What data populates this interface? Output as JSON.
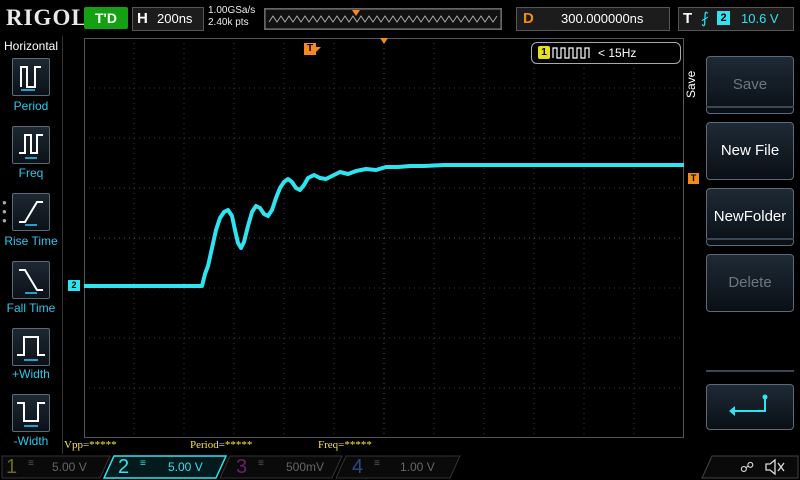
{
  "header": {
    "brand": "RIGOL",
    "run_status": "T'D",
    "timebase_label": "H",
    "timebase_value": "200ns",
    "sample_rate": "1.00GSa/s",
    "memory_depth": "2.40k pts",
    "delay_label": "D",
    "delay_value": "300.000000ns",
    "trigger_label": "T",
    "trigger_source": "2",
    "trigger_level": "10.6 V"
  },
  "left_menu": {
    "title": "Horizontal",
    "items": [
      {
        "label": "Period",
        "icon": "period-icon"
      },
      {
        "label": "Freq",
        "icon": "freq-icon"
      },
      {
        "label": "Rise Time",
        "icon": "rise-time-icon"
      },
      {
        "label": "Fall Time",
        "icon": "fall-time-icon"
      },
      {
        "label": "+Width",
        "icon": "positive-width-icon"
      },
      {
        "label": "-Width",
        "icon": "negative-width-icon"
      }
    ]
  },
  "screen": {
    "freq_counter_channel": "1",
    "freq_counter_value": "< 15Hz",
    "trigger_marker": "T",
    "ch2_marker": "2",
    "trigger_level_marker": "T"
  },
  "right_menu": {
    "title": "Save",
    "buttons": [
      {
        "label": "Save",
        "enabled": false
      },
      {
        "label": "New File",
        "enabled": true
      },
      {
        "label": "NewFolder",
        "enabled": true
      },
      {
        "label": "Delete",
        "enabled": false
      },
      {
        "label": "",
        "icon": "enter-icon",
        "enabled": true
      }
    ]
  },
  "measurements": {
    "vpp": "Vpp=*****",
    "period": "Period=*****",
    "freq": "Freq=*****"
  },
  "channels": [
    {
      "num": "1",
      "scale": "5.00 V",
      "active": false,
      "color": "#c8c820"
    },
    {
      "num": "2",
      "scale": "5.00 V",
      "active": true,
      "color": "#2ee4f0"
    },
    {
      "num": "3",
      "scale": "500mV",
      "active": false,
      "color": "#d020d0"
    },
    {
      "num": "4",
      "scale": "1.00 V",
      "active": false,
      "color": "#3a7ae0"
    }
  ],
  "colors": {
    "ch2": "#2ee4f0",
    "accent_orange": "#f28a1e",
    "measure_yellow": "#f6e53a"
  }
}
